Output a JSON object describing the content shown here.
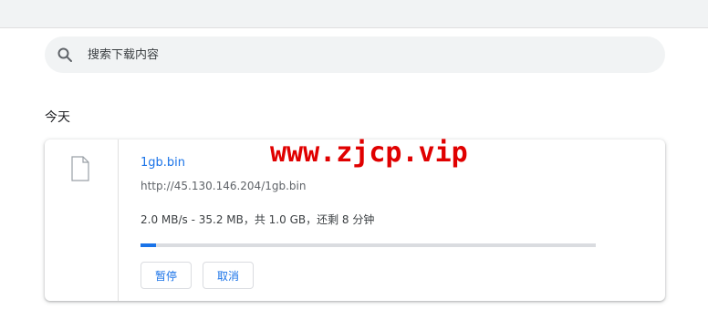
{
  "search": {
    "placeholder": "搜索下载内容",
    "icon": "search-icon"
  },
  "section": {
    "title": "今天"
  },
  "download": {
    "file_name": "1gb.bin",
    "url": "http://45.130.146.204/1gb.bin",
    "status": "2.0 MB/s - 35.2 MB，共 1.0 GB，还剩 8 分钟",
    "progress_fraction": 0.034,
    "file_icon": "file-icon",
    "pause_label": "暂停",
    "cancel_label": "取消"
  },
  "watermark": {
    "text": "www.zjcp.vip"
  },
  "colors": {
    "accent": "#1a73e8",
    "watermark": "#e00000"
  }
}
